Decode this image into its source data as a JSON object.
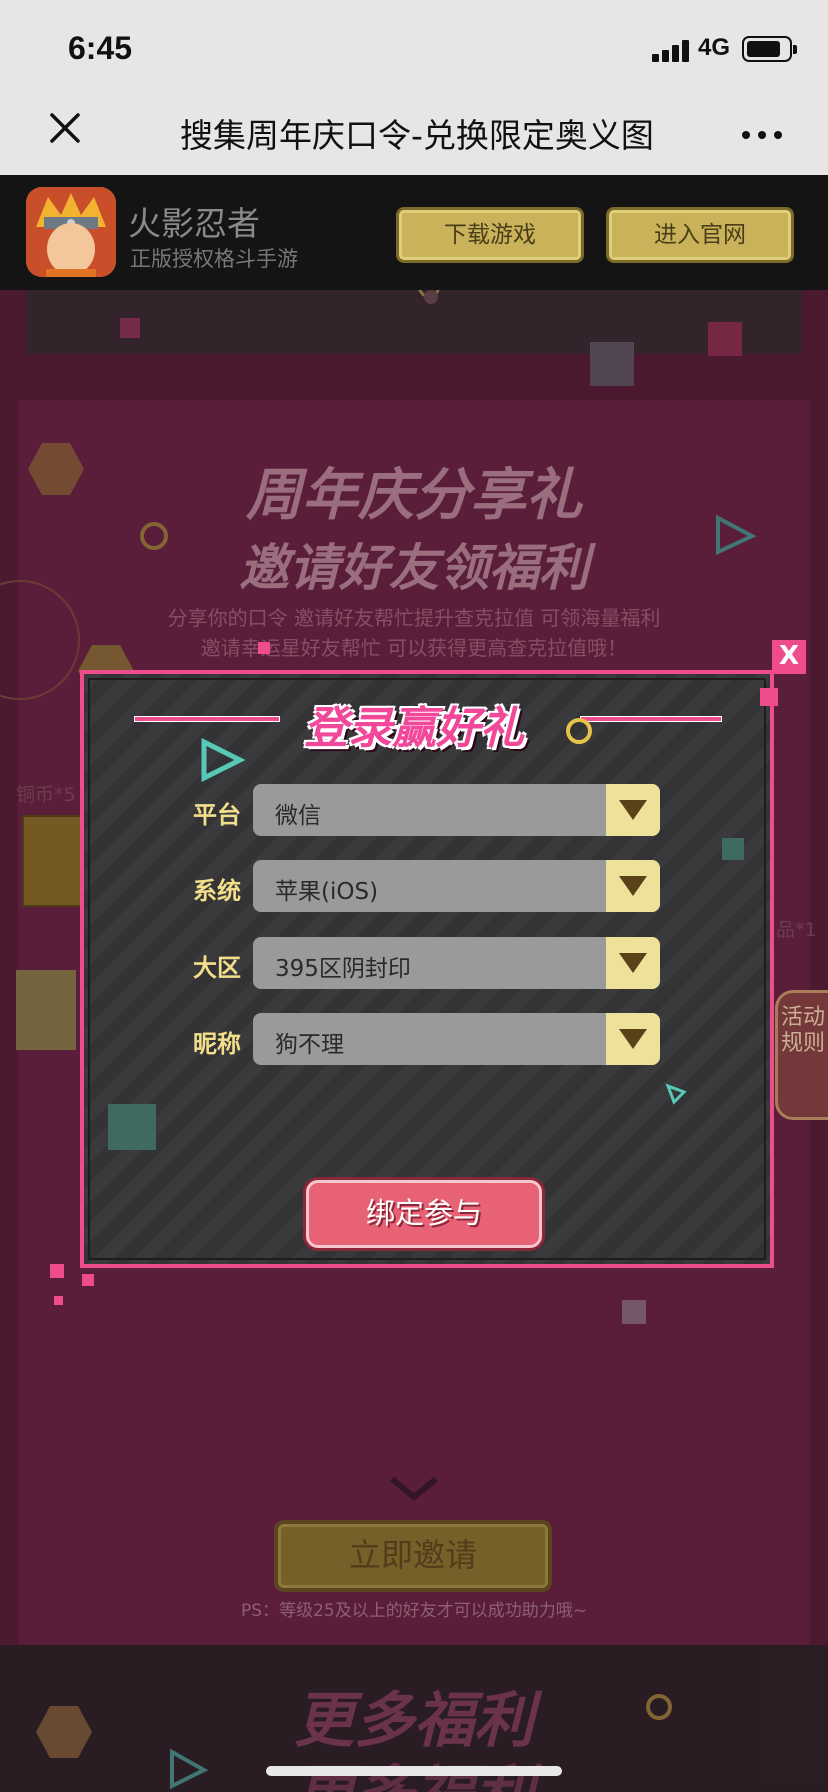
{
  "status_bar": {
    "time": "6:45",
    "network": "4G"
  },
  "nav": {
    "title": "搜集周年庆口令-兑换限定奥义图"
  },
  "app_banner": {
    "name": "火影忍者",
    "description": "正版授权格斗手游",
    "download_label": "下载游戏",
    "official_label": "进入官网"
  },
  "hero": {
    "line1": "周年庆分享礼",
    "line2": "邀请好友领福利",
    "sub1": "分享你的口令 邀请好友帮忙提升查克拉值 可领海量福利",
    "sub2": "邀请幸运星好友帮忙 可以获得更高查克拉值哦！"
  },
  "side": {
    "left_item": "铜币*5",
    "right_item": "品*1",
    "left_count": "5"
  },
  "rules_tab": {
    "label": "活动规则"
  },
  "modal": {
    "close_label": "X",
    "title": "登录赢好礼",
    "fields": [
      {
        "label": "平台",
        "value": "微信"
      },
      {
        "label": "系统",
        "value": "苹果(iOS)"
      },
      {
        "label": "大区",
        "value": "395区阴封印"
      },
      {
        "label": "昵称",
        "value": "狗不理"
      }
    ],
    "submit_label": "绑定参与"
  },
  "invite": {
    "button_label": "立即邀请",
    "note": "PS：等级25及以上的好友才可以成功助力哦~"
  },
  "more": {
    "line1": "更多福利",
    "line2": "更多福利"
  },
  "colors": {
    "accent_pink": "#ee4c8c",
    "gold": "#c9b25a",
    "label_yellow": "#f3df8a"
  }
}
